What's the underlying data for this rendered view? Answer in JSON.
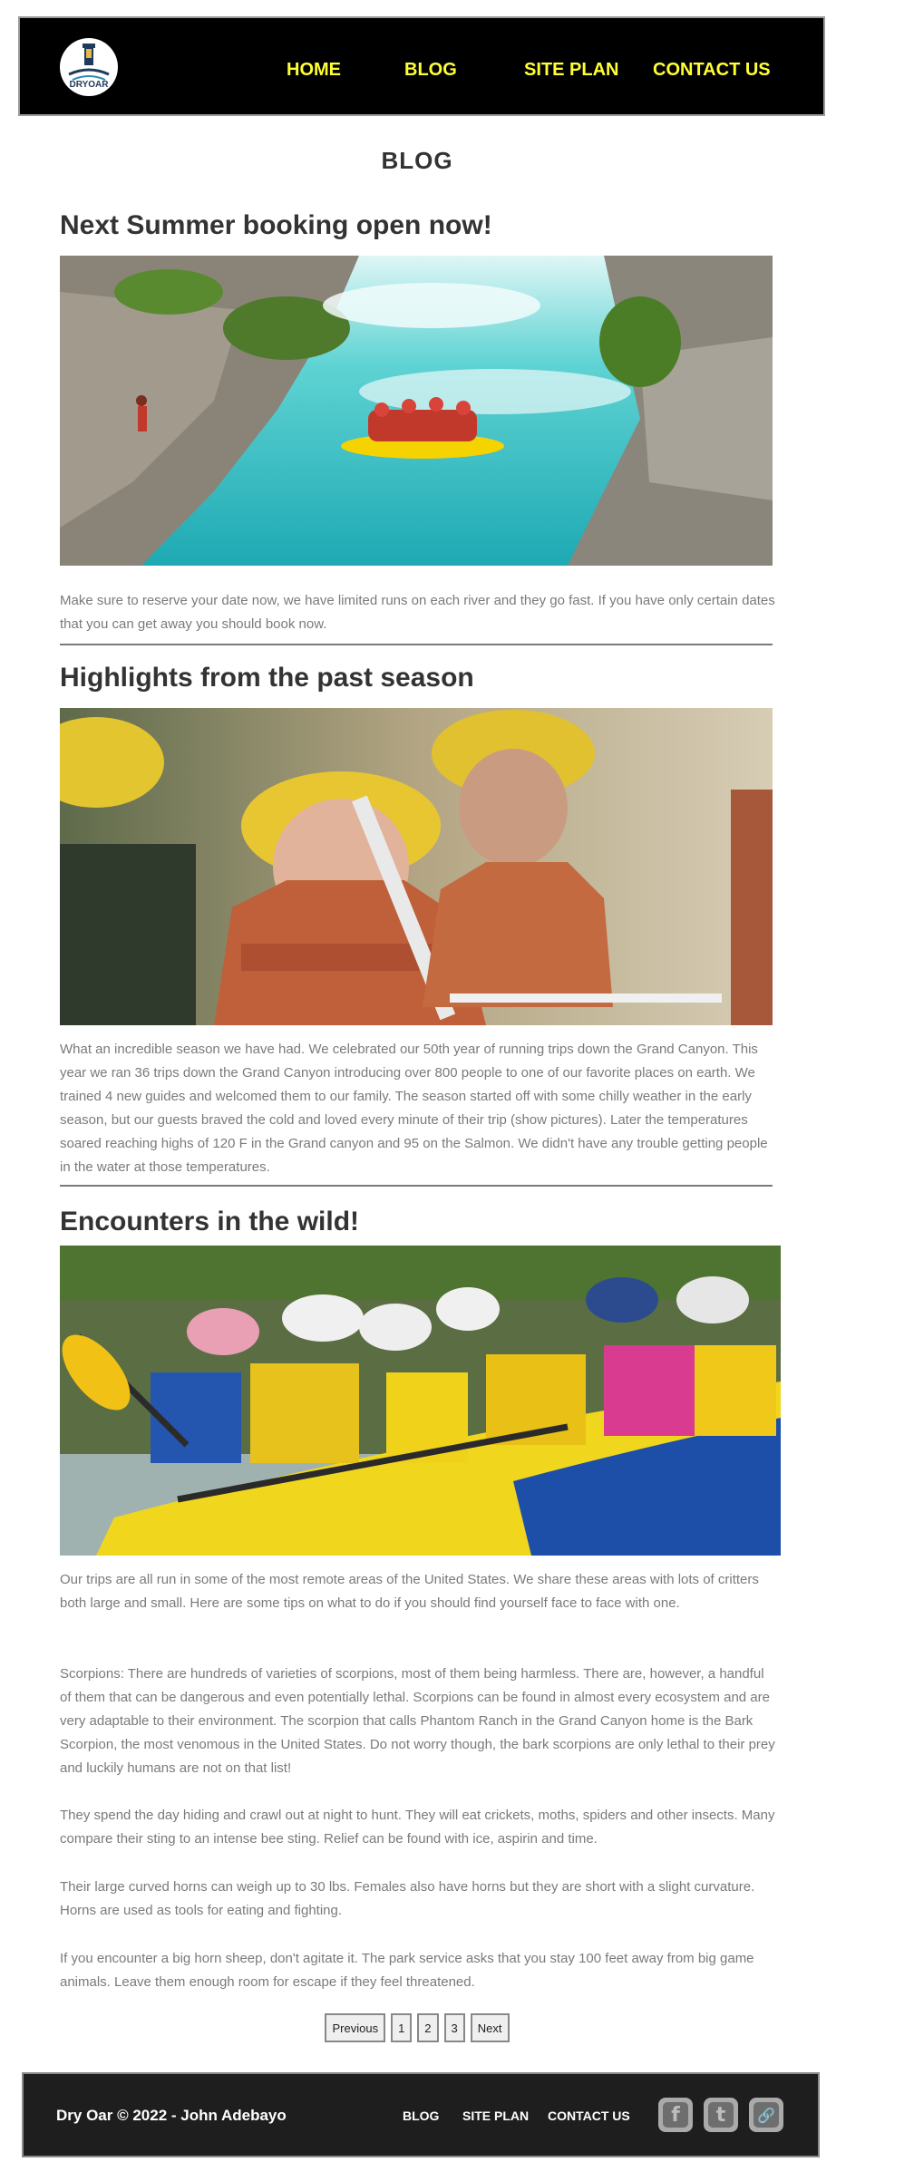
{
  "logo": {
    "text": "DRYOAR"
  },
  "nav": {
    "home": "HOME",
    "blog": "BLOG",
    "site_plan": "SITE PLAN",
    "contact": "CONTACT US"
  },
  "page": {
    "title": "BLOG"
  },
  "posts": [
    {
      "title": "Next Summer booking open now!",
      "body": "Make sure to reserve your date now, we have limited runs on each river and they go fast. If you have only certain dates that you can get away you should book now."
    },
    {
      "title": "Highlights from the past season",
      "body": "What an incredible season we have had. We celebrated our 50th year of running trips down the Grand Canyon. This year we ran 36 trips down the Grand Canyon introducing over 800 people to one of our favorite places on earth. We trained 4 new guides and welcomed them to our family. The season started off with some chilly weather in the early season, but our guests braved the cold and loved every minute of their trip (show pictures). Later the temperatures soared reaching highs of 120 F in the Grand canyon and 95 on the Salmon. We didn't have any trouble getting people in the water at those temperatures."
    },
    {
      "title": "Encounters in the wild!",
      "paragraphs": [
        "Our trips are all run in some of the most remote areas of the United States. We share these areas with lots of critters both large and small. Here are some tips on what to do if you should find yourself face to face with one.",
        "Scorpions: There are hundreds of varieties of scorpions, most of them being harmless. There are, however, a handful of them that can be dangerous and even potentially lethal. Scorpions can be found in almost every ecosystem and are very adaptable to their environment. The scorpion that calls Phantom Ranch in the Grand Canyon home is the Bark Scorpion, the most venomous in the United States. Do not worry though, the bark scorpions are only lethal to their prey and luckily humans are not on that list!",
        "They spend the day hiding and crawl out at night to hunt. They will eat crickets, moths, spiders and other insects. Many compare their sting to an intense bee sting. Relief can be found with ice, aspirin and time.",
        "Their large curved horns can weigh up to 30 lbs. Females also have horns but they are short with a slight curvature. Horns are used as tools for eating and fighting.",
        "If you encounter a big horn sheep, don't agitate it. The park service asks that you stay 100 feet away from big game animals. Leave them enough room for escape if they feel threatened."
      ]
    }
  ],
  "pagination": {
    "previous": "Previous",
    "pages": [
      "1",
      "2",
      "3"
    ],
    "next": "Next"
  },
  "footer": {
    "copyright": "Dry Oar © 2022 - John Adebayo",
    "links": {
      "blog": "BLOG",
      "site_plan": "SITE PLAN",
      "contact": "CONTACT US"
    },
    "social_icons": [
      "facebook-icon",
      "twitter-icon",
      "link-icon"
    ]
  },
  "colors": {
    "nav_text": "#ffff33",
    "header_bg": "#000000",
    "footer_bg": "#1e1e1e",
    "body_text": "#7a7a7a",
    "heading_text": "#333333"
  }
}
